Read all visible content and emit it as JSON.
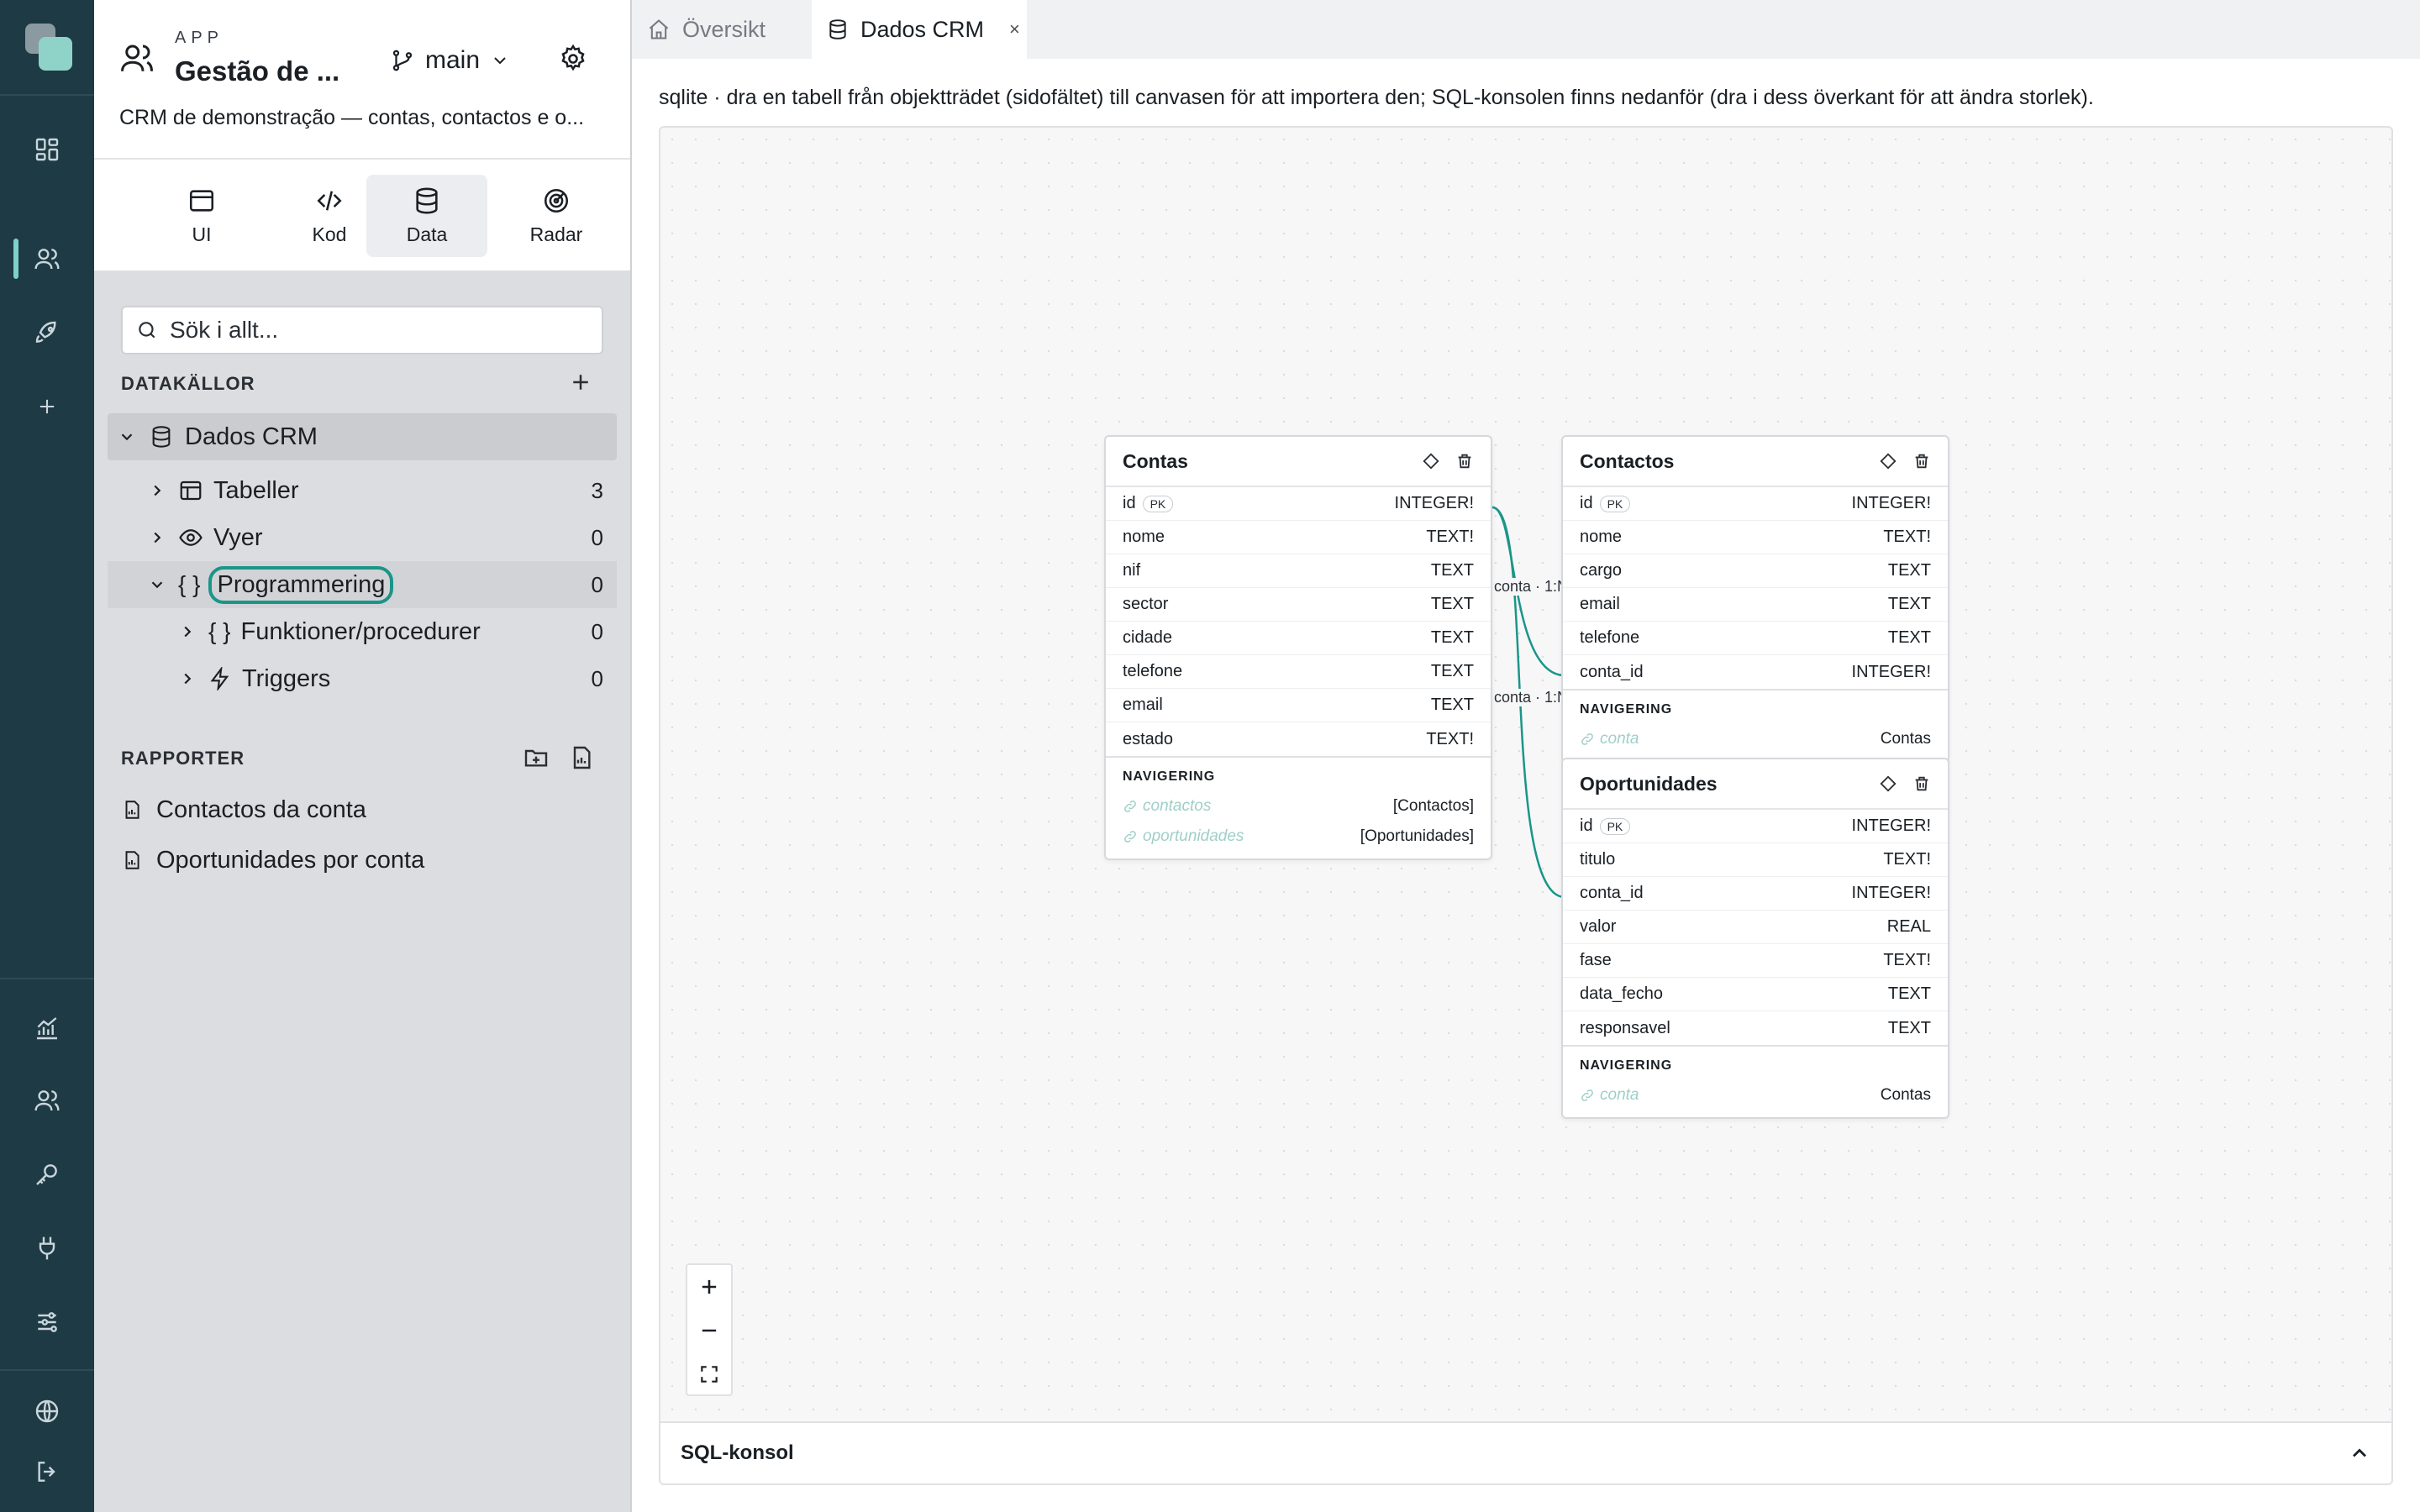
{
  "app": {
    "kicker": "APP",
    "title": "Gestão de ...",
    "description": "CRM de demonstração — contas, contactos e o...",
    "branch": "main"
  },
  "mode_tabs": [
    {
      "label": "UI",
      "icon": "browser-window-icon"
    },
    {
      "label": "Kod",
      "icon": "code-icon"
    },
    {
      "label": "Data",
      "icon": "database-icon"
    },
    {
      "label": "Radar",
      "icon": "radar-icon"
    }
  ],
  "search": {
    "placeholder": "Sök i allt..."
  },
  "datasources": {
    "title": "DATAKÄLLOR",
    "root": "Dados CRM",
    "items": [
      {
        "label": "Tabeller",
        "count": "3"
      },
      {
        "label": "Vyer",
        "count": "0"
      },
      {
        "label": "Programmering",
        "count": "0"
      },
      {
        "label": "Funktioner/procedurer",
        "count": "0"
      },
      {
        "label": "Triggers",
        "count": "0"
      }
    ]
  },
  "reports": {
    "title": "RAPPORTER",
    "items": [
      "Contactos da conta",
      "Oportunidades por conta"
    ]
  },
  "tabs": [
    {
      "label": "Översikt"
    },
    {
      "label": "Dados CRM",
      "close": "×"
    }
  ],
  "hint": "sqlite · dra en tabell från objektträdet (sidofältet) till canvasen för att importera den; SQL-konsolen finns nedanför (dra i dess överkant för att ändra storlek).",
  "relations": {
    "label": "conta · 1:N"
  },
  "tables": {
    "contas": {
      "name": "Contas",
      "pk_badge": "PK",
      "columns": [
        {
          "name": "id",
          "type": "INTEGER!"
        },
        {
          "name": "nome",
          "type": "TEXT!"
        },
        {
          "name": "nif",
          "type": "TEXT"
        },
        {
          "name": "sector",
          "type": "TEXT"
        },
        {
          "name": "cidade",
          "type": "TEXT"
        },
        {
          "name": "telefone",
          "type": "TEXT"
        },
        {
          "name": "email",
          "type": "TEXT"
        },
        {
          "name": "estado",
          "type": "TEXT!"
        }
      ],
      "nav_title": "NAVIGERING",
      "nav": [
        {
          "name": "contactos",
          "target": "[Contactos]"
        },
        {
          "name": "oportunidades",
          "target": "[Oportunidades]"
        }
      ]
    },
    "contactos": {
      "name": "Contactos",
      "pk_badge": "PK",
      "columns": [
        {
          "name": "id",
          "type": "INTEGER!"
        },
        {
          "name": "nome",
          "type": "TEXT!"
        },
        {
          "name": "cargo",
          "type": "TEXT"
        },
        {
          "name": "email",
          "type": "TEXT"
        },
        {
          "name": "telefone",
          "type": "TEXT"
        },
        {
          "name": "conta_id",
          "type": "INTEGER!"
        }
      ],
      "nav_title": "NAVIGERING",
      "nav": [
        {
          "name": "conta",
          "target": "Contas"
        }
      ]
    },
    "oportunidades": {
      "name": "Oportunidades",
      "pk_badge": "PK",
      "columns": [
        {
          "name": "id",
          "type": "INTEGER!"
        },
        {
          "name": "titulo",
          "type": "TEXT!"
        },
        {
          "name": "conta_id",
          "type": "INTEGER!"
        },
        {
          "name": "valor",
          "type": "REAL"
        },
        {
          "name": "fase",
          "type": "TEXT!"
        },
        {
          "name": "data_fecho",
          "type": "TEXT"
        },
        {
          "name": "responsavel",
          "type": "TEXT"
        }
      ],
      "nav_title": "NAVIGERING",
      "nav": [
        {
          "name": "conta",
          "target": "Contas"
        }
      ]
    }
  },
  "sql_console": {
    "label": "SQL-konsol"
  },
  "colors": {
    "rail": "#1e3a44",
    "accent": "#1b9588",
    "sidebar": "#dcdde0"
  }
}
